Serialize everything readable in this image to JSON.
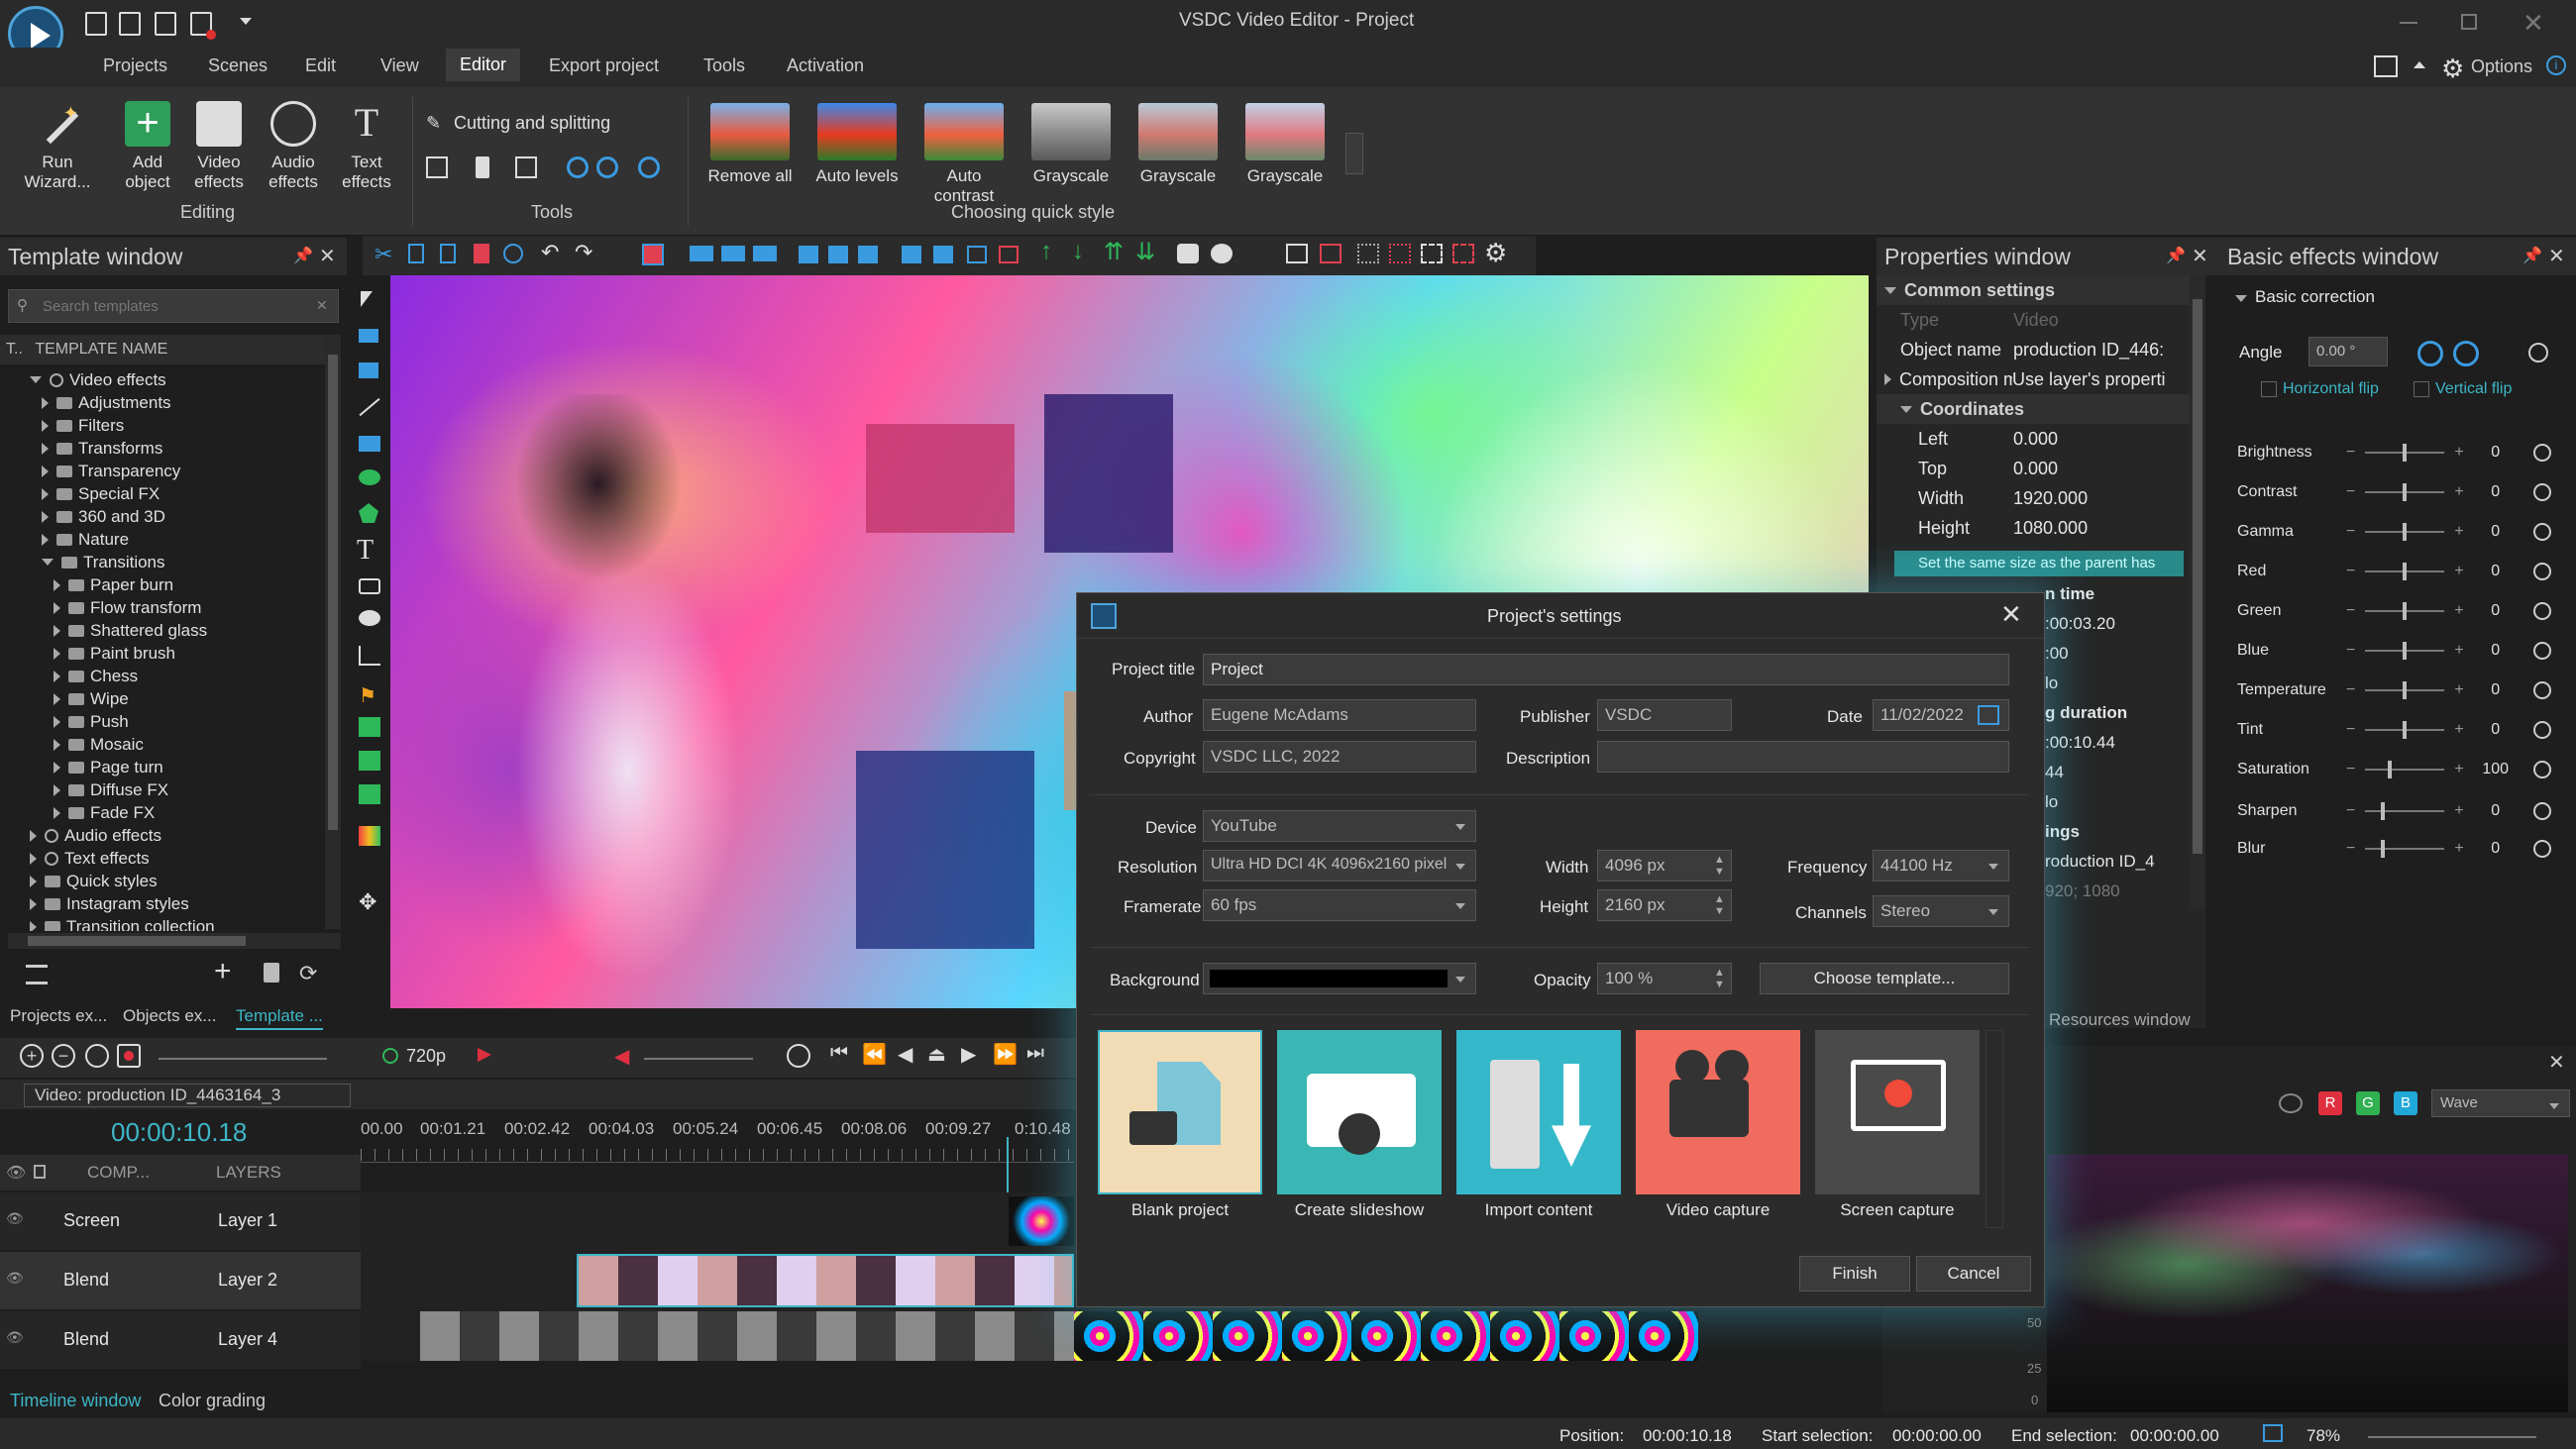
{
  "app": {
    "title": "VSDC Video Editor - Project",
    "options_label": "Options"
  },
  "menu": [
    "Projects",
    "Scenes",
    "Edit",
    "View",
    "Editor",
    "Export project",
    "Tools",
    "Activation"
  ],
  "ribbon": {
    "editing": {
      "group": "Editing",
      "buttons": [
        "Run Wizard...",
        "Add object",
        "Video effects",
        "Audio effects",
        "Text effects"
      ]
    },
    "tools": {
      "group": "Tools",
      "cutting": "Cutting and splitting"
    },
    "quick_style": {
      "group": "Choosing quick style",
      "items": [
        "Remove all",
        "Auto levels",
        "Auto contrast",
        "Grayscale",
        "Grayscale",
        "Grayscale"
      ]
    }
  },
  "template_window": {
    "title": "Template window",
    "search_placeholder": "Search templates",
    "column": "TEMPLATE NAME",
    "column_prefix": "T..",
    "tree": [
      {
        "label": "Video effects",
        "level": 0,
        "open": true
      },
      {
        "label": "Adjustments",
        "level": 1
      },
      {
        "label": "Filters",
        "level": 1
      },
      {
        "label": "Transforms",
        "level": 1
      },
      {
        "label": "Transparency",
        "level": 1
      },
      {
        "label": "Special FX",
        "level": 1
      },
      {
        "label": "360 and 3D",
        "level": 1
      },
      {
        "label": "Nature",
        "level": 1
      },
      {
        "label": "Transitions",
        "level": 1,
        "open": true
      },
      {
        "label": "Paper burn",
        "level": 2
      },
      {
        "label": "Flow transform",
        "level": 2
      },
      {
        "label": "Shattered glass",
        "level": 2
      },
      {
        "label": "Paint brush",
        "level": 2
      },
      {
        "label": "Chess",
        "level": 2
      },
      {
        "label": "Wipe",
        "level": 2
      },
      {
        "label": "Push",
        "level": 2
      },
      {
        "label": "Mosaic",
        "level": 2
      },
      {
        "label": "Page turn",
        "level": 2
      },
      {
        "label": "Diffuse FX",
        "level": 2
      },
      {
        "label": "Fade FX",
        "level": 2
      },
      {
        "label": "Audio effects",
        "level": 0
      },
      {
        "label": "Text effects",
        "level": 0
      },
      {
        "label": "Quick styles",
        "level": 0
      },
      {
        "label": "Instagram styles",
        "level": 0
      },
      {
        "label": "Transition collection",
        "level": 0
      }
    ],
    "tabs": [
      "Projects ex...",
      "Objects ex...",
      "Template ..."
    ]
  },
  "properties": {
    "title": "Properties window",
    "section_common": "Common settings",
    "type_label": "Type",
    "type_value": "Video",
    "object_name_label": "Object name",
    "object_name_value": "production ID_446:",
    "composition_label": "Composition mc",
    "composition_value": "Use layer's properti",
    "section_coords": "Coordinates",
    "coords": [
      {
        "label": "Left",
        "value": "0.000"
      },
      {
        "label": "Top",
        "value": "0.000"
      },
      {
        "label": "Width",
        "value": "1920.000"
      },
      {
        "label": "Height",
        "value": "1080.000"
      }
    ],
    "same_size": "Set the same size as the parent has",
    "peek": [
      "n time",
      ":00:03.20",
      ":00",
      "lo",
      "g duration",
      ":00:10.44",
      "44",
      "lo",
      "ings",
      "roduction ID_4",
      "920; 1080"
    ],
    "resources": "Resources window"
  },
  "basic_effects": {
    "title": "Basic effects window",
    "section": "Basic correction",
    "angle_label": "Angle",
    "angle_value": "0.00 °",
    "hflip": "Horizontal flip",
    "vflip": "Vertical flip",
    "rows": [
      {
        "label": "Brightness",
        "value": "0",
        "pos": 0.5
      },
      {
        "label": "Contrast",
        "value": "0",
        "pos": 0.5
      },
      {
        "label": "Gamma",
        "value": "0",
        "pos": 0.5
      },
      {
        "label": "Red",
        "value": "0",
        "pos": 0.5
      },
      {
        "label": "Green",
        "value": "0",
        "pos": 0.5
      },
      {
        "label": "Blue",
        "value": "0",
        "pos": 0.5
      },
      {
        "label": "Temperature",
        "value": "0",
        "pos": 0.5
      },
      {
        "label": "Tint",
        "value": "0",
        "pos": 0.5
      },
      {
        "label": "Saturation",
        "value": "100",
        "pos": 0.3
      },
      {
        "label": "Sharpen",
        "value": "0",
        "pos": 0.2
      },
      {
        "label": "Blur",
        "value": "0",
        "pos": 0.2
      }
    ]
  },
  "dialog": {
    "title": "Project's settings",
    "project_title_label": "Project title",
    "project_title": "Project",
    "author_label": "Author",
    "author": "Eugene McAdams",
    "publisher_label": "Publisher",
    "publisher": "VSDC",
    "date_label": "Date",
    "date": "11/02/2022",
    "copyright_label": "Copyright",
    "copyright": "VSDC LLC, 2022",
    "description_label": "Description",
    "description": "",
    "device_label": "Device",
    "device": "YouTube",
    "resolution_label": "Resolution",
    "resolution": "Ultra HD DCI 4K 4096x2160 pixel",
    "width_label": "Width",
    "width": "4096 px",
    "frequency_label": "Frequency",
    "frequency": "44100 Hz",
    "framerate_label": "Framerate",
    "framerate": "60 fps",
    "height_label": "Height",
    "height": "2160 px",
    "channels_label": "Channels",
    "channels": "Stereo",
    "background_label": "Background",
    "background_color": "#000000",
    "opacity_label": "Opacity",
    "opacity": "100 %",
    "choose_template": "Choose template...",
    "tiles": [
      "Blank project",
      "Create slideshow",
      "Import content",
      "Video capture",
      "Screen capture"
    ],
    "finish": "Finish",
    "cancel": "Cancel"
  },
  "timeline": {
    "tab_label": "Video: production ID_4463164_3",
    "time": "00:00:10.18",
    "ticks": [
      "00.00",
      "00:01.21",
      "00:02.42",
      "00:04.03",
      "00:05.24",
      "00:06.45",
      "00:08.06",
      "00:09.27",
      "0:10.48"
    ],
    "header": [
      "COMP...",
      "LAYERS"
    ],
    "rows": [
      {
        "blend": "Screen",
        "layer": "Layer 1"
      },
      {
        "blend": "Blend",
        "layer": "Layer 2"
      },
      {
        "blend": "Blend",
        "layer": "Layer 4"
      }
    ],
    "quality": "720p",
    "tabs": [
      "Timeline window",
      "Color grading"
    ]
  },
  "scopes": {
    "mode": "Wave",
    "channels": [
      "R",
      "G",
      "B"
    ],
    "scale": [
      "50",
      "25",
      "0"
    ]
  },
  "status": {
    "position_label": "Position:",
    "position": "00:00:10.18",
    "start_label": "Start selection:",
    "start": "00:00:00.00",
    "end_label": "End selection:",
    "end": "00:00:00.00",
    "zoom": "78%"
  }
}
